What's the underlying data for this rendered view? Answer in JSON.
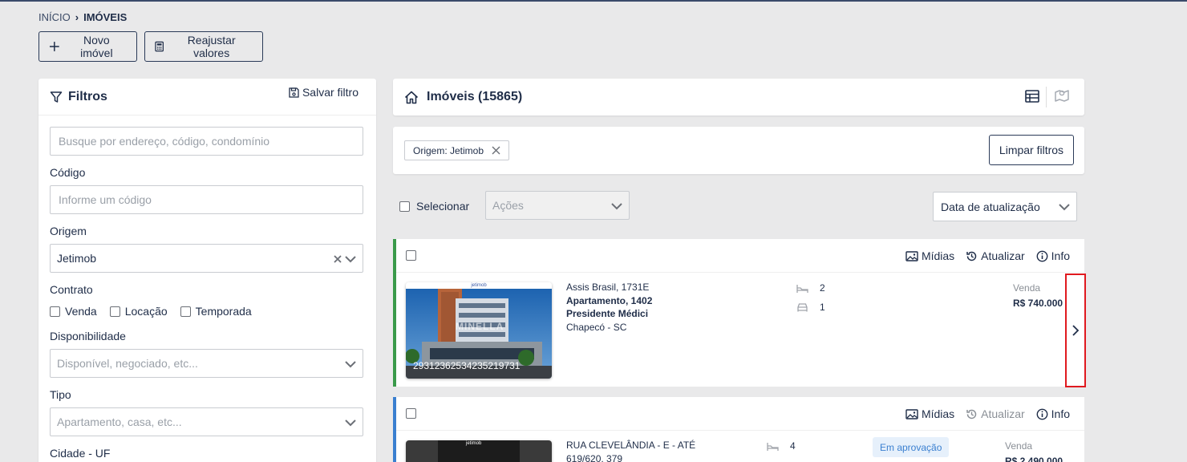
{
  "breadcrumb": {
    "home": "INÍCIO",
    "current": "IMÓVEIS"
  },
  "toolbar": {
    "new_label": "Novo imóvel",
    "adjust_label": "Reajustar valores"
  },
  "filters": {
    "title": "Filtros",
    "save_label": "Salvar filtro",
    "search_placeholder": "Busque por endereço, código, condomínio",
    "code_label": "Código",
    "code_placeholder": "Informe um código",
    "origin_label": "Origem",
    "origin_value": "Jetimob",
    "contract_label": "Contrato",
    "contract_options": [
      "Venda",
      "Locação",
      "Temporada"
    ],
    "availability_label": "Disponibilidade",
    "availability_placeholder": "Disponível, negociado, etc...",
    "type_label": "Tipo",
    "type_placeholder": "Apartamento, casa, etc...",
    "city_label": "Cidade - UF"
  },
  "listing": {
    "title": "Imóveis (15865)",
    "active_filter": "Origem: Jetimob",
    "clear_label": "Limpar filtros",
    "select_label": "Selecionar",
    "actions_placeholder": "Ações",
    "sort_value": "Data de atualização"
  },
  "card_actions": {
    "media": "Mídias",
    "update": "Atualizar",
    "info": "Info"
  },
  "properties": [
    {
      "street": "Assis Brasil, 1731E",
      "unit": "Apartamento, 1402",
      "neighborhood": "Presidente Médici",
      "city": "Chapecó - SC",
      "bedrooms": "2",
      "parking": "1",
      "contract": "Venda",
      "price": "R$ 740.000",
      "photo_code": "29312362534235219731",
      "watermark": "MINELLA",
      "brand": "jetimob",
      "accent": "#3a9a4a"
    },
    {
      "street": "RUA CLEVELÂNDIA - E - ATÉ",
      "unit": "619/620, 379",
      "status_badge": "Em aprovação",
      "bedrooms": "4",
      "contract": "Venda",
      "price": "R$ 2.490.000",
      "brand": "jetimob",
      "accent": "#3a7fd0"
    }
  ],
  "colors": {
    "primary": "#1f2d48",
    "highlight": "#e0191f",
    "badge_bg": "#e6f0fb",
    "badge_text": "#3a7fd0"
  }
}
